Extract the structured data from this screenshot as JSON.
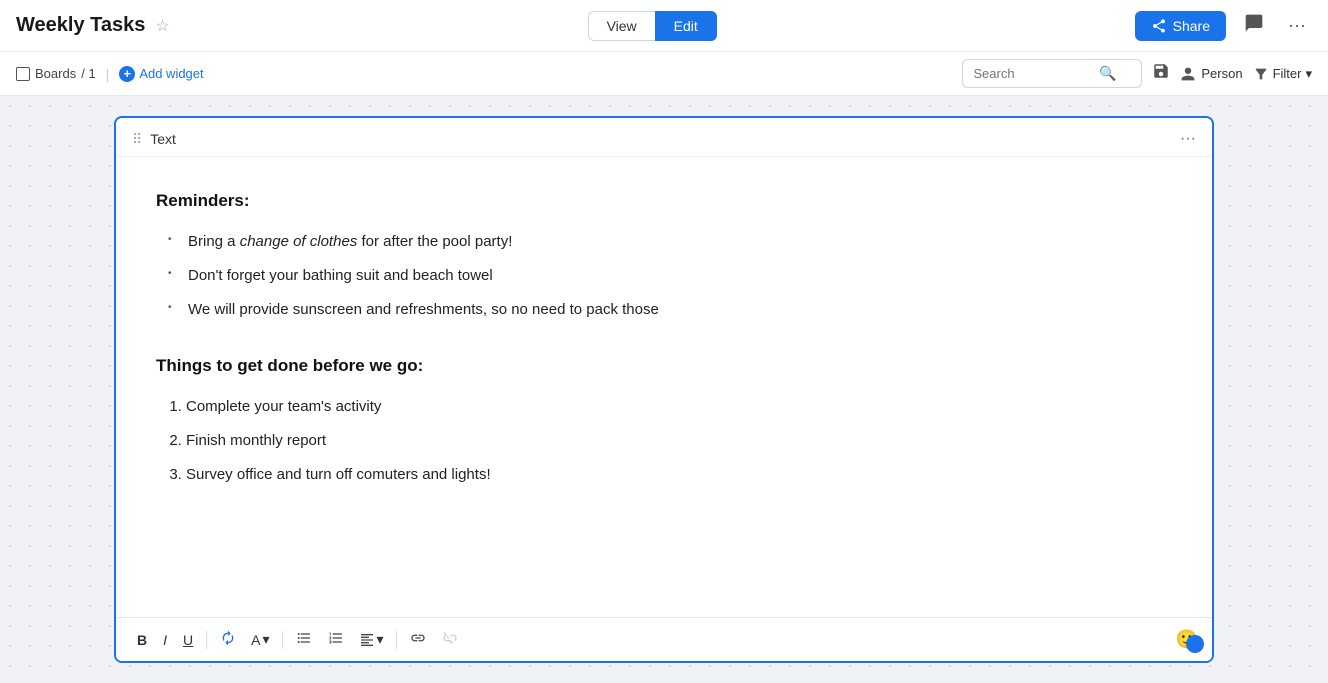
{
  "header": {
    "title": "Weekly Tasks",
    "view_label": "View",
    "edit_label": "Edit",
    "share_label": "Share"
  },
  "toolbar": {
    "boards_label": "Boards",
    "boards_count": "1",
    "add_widget_label": "Add widget",
    "search_placeholder": "Search",
    "person_label": "Person",
    "filter_label": "Filter"
  },
  "widget": {
    "title": "Text",
    "reminders_heading": "Reminders:",
    "bullets": [
      {
        "text_before": "Bring a ",
        "italic": "change of clothes",
        "text_after": " for after the pool party!"
      },
      {
        "text_plain": "Don't forget your bathing suit and beach towel"
      },
      {
        "text_plain": "We will provide sunscreen and refreshments, so no need to pack those"
      }
    ],
    "tasks_heading": "Things to get done before we go:",
    "numbered": [
      "Complete your team's activity",
      "Finish monthly report",
      "Survey office and turn off comuters and lights!"
    ],
    "format_toolbar": {
      "bold": "B",
      "italic": "I",
      "underline": "U",
      "text_color": "A",
      "dropdown_arrow": "▾"
    }
  }
}
